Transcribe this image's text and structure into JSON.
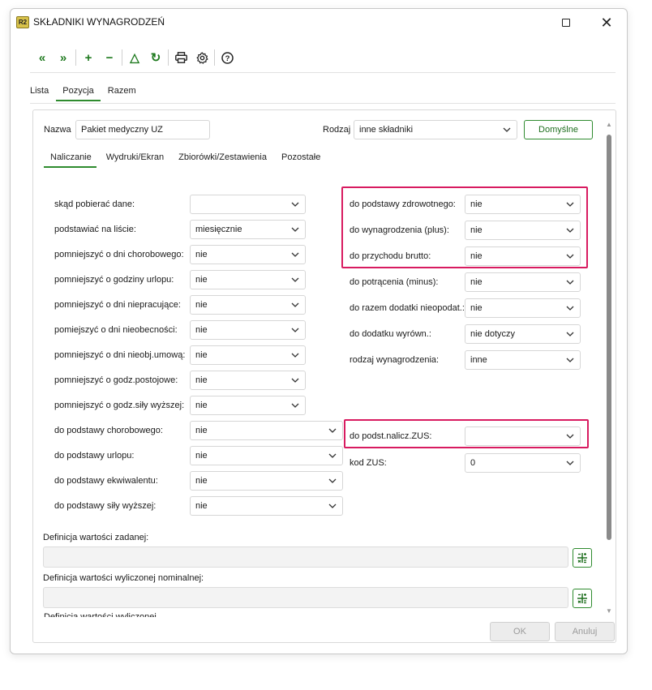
{
  "window": {
    "app_logo": "R2",
    "title": "SKŁADNIKI WYNAGRODZEŃ",
    "maximize_icon": "maximize-icon",
    "close_icon": "close-icon"
  },
  "toolbar": [
    {
      "name": "first-icon",
      "glyph": "«"
    },
    {
      "name": "last-icon",
      "glyph": "»"
    },
    {
      "name": "add-icon",
      "glyph": "+"
    },
    {
      "name": "remove-icon",
      "glyph": "−"
    },
    {
      "name": "triangle-icon",
      "glyph": "△"
    },
    {
      "name": "refresh-icon",
      "glyph": "↻"
    },
    {
      "name": "print-icon",
      "glyph": "🖶"
    },
    {
      "name": "settings-icon",
      "glyph": "⚙"
    },
    {
      "name": "help-icon",
      "glyph": "?"
    }
  ],
  "main_tabs": [
    "Lista",
    "Pozycja",
    "Razem"
  ],
  "main_tab_active": "Pozycja",
  "header": {
    "name_label": "Nazwa",
    "name_value": "Pakiet medyczny UZ",
    "type_label": "Rodzaj",
    "type_value": "inne składniki",
    "default_button": "Domyślne"
  },
  "sub_tabs": [
    "Naliczanie",
    "Wydruki/Ekran",
    "Zbiorówki/Zestawienia",
    "Pozostałe"
  ],
  "sub_tab_active": "Naliczanie",
  "left_fields": [
    {
      "label": "skąd pobierać dane:",
      "value": ""
    },
    {
      "label": "podstawiać na liście:",
      "value": "miesięcznie"
    },
    {
      "label": "pomniejszyć o dni chorobowego:",
      "value": "nie"
    },
    {
      "label": "pomniejszyć o godziny urlopu:",
      "value": "nie"
    },
    {
      "label": "pomniejszyć o dni niepracujące:",
      "value": "nie"
    },
    {
      "label": "pomiejszyć o dni nieobecności:",
      "value": "nie"
    },
    {
      "label": "pomniejszyć o dni nieobj.umową:",
      "value": "nie"
    },
    {
      "label": "pomniejszyć o godz.postojowe:",
      "value": "nie"
    },
    {
      "label": "pomniejszyć o godz.siły wyższej:",
      "value": "nie"
    },
    {
      "label": "do podstawy chorobowego:",
      "value": "nie"
    },
    {
      "label": "do podstawy urlopu:",
      "value": "nie"
    },
    {
      "label": "do podstawy ekwiwalentu:",
      "value": "nie"
    },
    {
      "label": "do podstawy siły wyższej:",
      "value": "nie"
    }
  ],
  "right_fields": [
    {
      "label": "do podstawy zdrowotnego:",
      "value": "nie"
    },
    {
      "label": "do wynagrodzenia (plus):",
      "value": "nie"
    },
    {
      "label": "do przychodu brutto:",
      "value": "nie"
    },
    {
      "label": "do potrącenia (minus):",
      "value": "nie"
    },
    {
      "label": "do razem dodatki nieopodat.:",
      "value": "nie"
    },
    {
      "label": "do dodatku wyrówn.:",
      "value": "nie dotyczy"
    },
    {
      "label": "rodzaj wynagrodzenia:",
      "value": "inne"
    }
  ],
  "zus_fields": [
    {
      "label": "do podst.nalicz.ZUS:",
      "value": ""
    },
    {
      "label": "kod ZUS:",
      "value": "0"
    }
  ],
  "definitions": {
    "set_value_label": "Definicja wartości zadanej:",
    "nominal_value_label": "Definicja wartości wyliczonej nominalnej:",
    "cut_label": "Definicja wartości wyliczonej..."
  },
  "dialog": {
    "ok": "OK",
    "cancel": "Anuluj"
  },
  "colors": {
    "accent": "#2e8b2e",
    "highlight": "#d81b60"
  }
}
